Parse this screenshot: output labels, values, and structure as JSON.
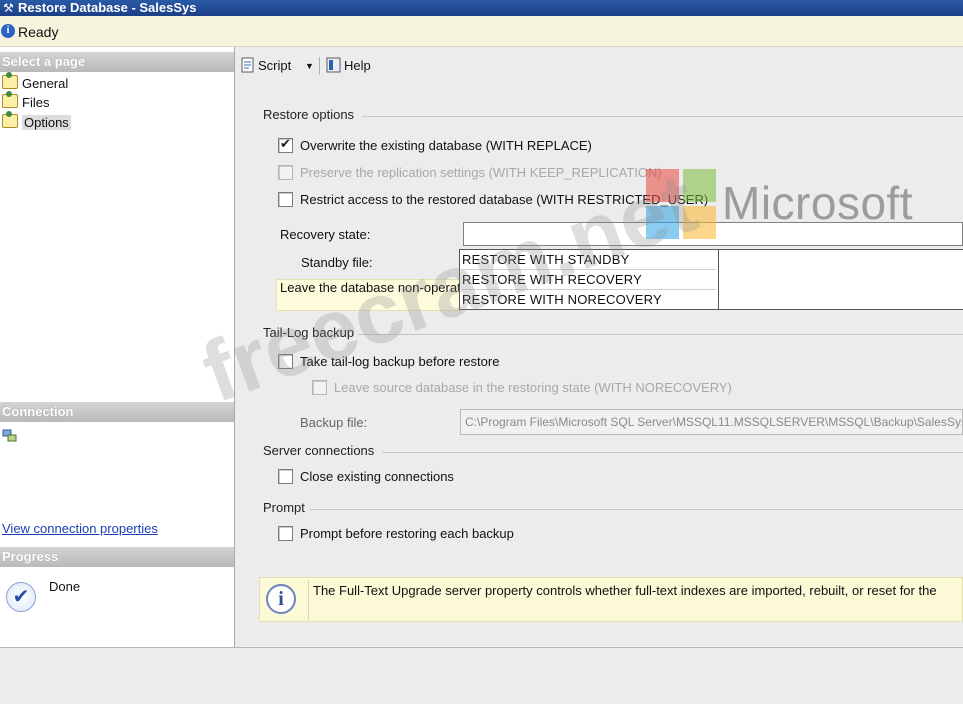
{
  "window": {
    "title": "Restore Database - SalesSys"
  },
  "status": {
    "text": "Ready"
  },
  "left_pane": {
    "select_page_header": "Select a page",
    "pages": [
      {
        "label": "General",
        "selected": false
      },
      {
        "label": "Files",
        "selected": false
      },
      {
        "label": "Options",
        "selected": true
      }
    ],
    "connection_header": "Connection",
    "view_connection_link": "View connection properties",
    "progress_header": "Progress",
    "progress_status": "Done"
  },
  "toolbar": {
    "script_label": "Script",
    "help_label": "Help"
  },
  "restore_options": {
    "title": "Restore options",
    "overwrite_label": "Overwrite the existing database (WITH REPLACE)",
    "overwrite_checked": true,
    "preserve_label": "Preserve the replication settings (WITH KEEP_REPLICATION)",
    "preserve_checked": false,
    "restrict_label": "Restrict access to the restored database (WITH RESTRICTED_USER)",
    "restrict_checked": false,
    "recovery_state_label": "Recovery state:",
    "recovery_state_value": "",
    "recovery_state_options": [
      "RESTORE WITH STANDBY",
      "RESTORE WITH RECOVERY",
      "RESTORE WITH NORECOVERY"
    ],
    "standby_file_label": "Standby file:",
    "recovery_description": "Leave the database non-operational"
  },
  "tail_log": {
    "title": "Tail-Log backup",
    "take_backup_label": "Take tail-log backup before restore",
    "take_backup_checked": false,
    "leave_source_label": "Leave source database in the restoring state (WITH NORECOVERY)",
    "leave_source_checked": false,
    "backup_file_label": "Backup file:",
    "backup_file_value": "C:\\Program Files\\Microsoft SQL Server\\MSSQL11.MSSQLSERVER\\MSSQL\\Backup\\SalesSys"
  },
  "server_connections": {
    "title": "Server connections",
    "close_label": "Close existing connections",
    "close_checked": false
  },
  "prompt": {
    "title": "Prompt",
    "prompt_label": "Prompt before restoring each backup",
    "prompt_checked": false
  },
  "info": {
    "text": "The Full-Text Upgrade server property controls whether full-text indexes are imported, rebuilt, or reset for the"
  },
  "watermarks": {
    "brand": "Microsoft",
    "site": "freecram.net",
    "logo_colors": [
      "#e9473f",
      "#7cbb3e",
      "#2ea3e6",
      "#fbb72e"
    ]
  }
}
